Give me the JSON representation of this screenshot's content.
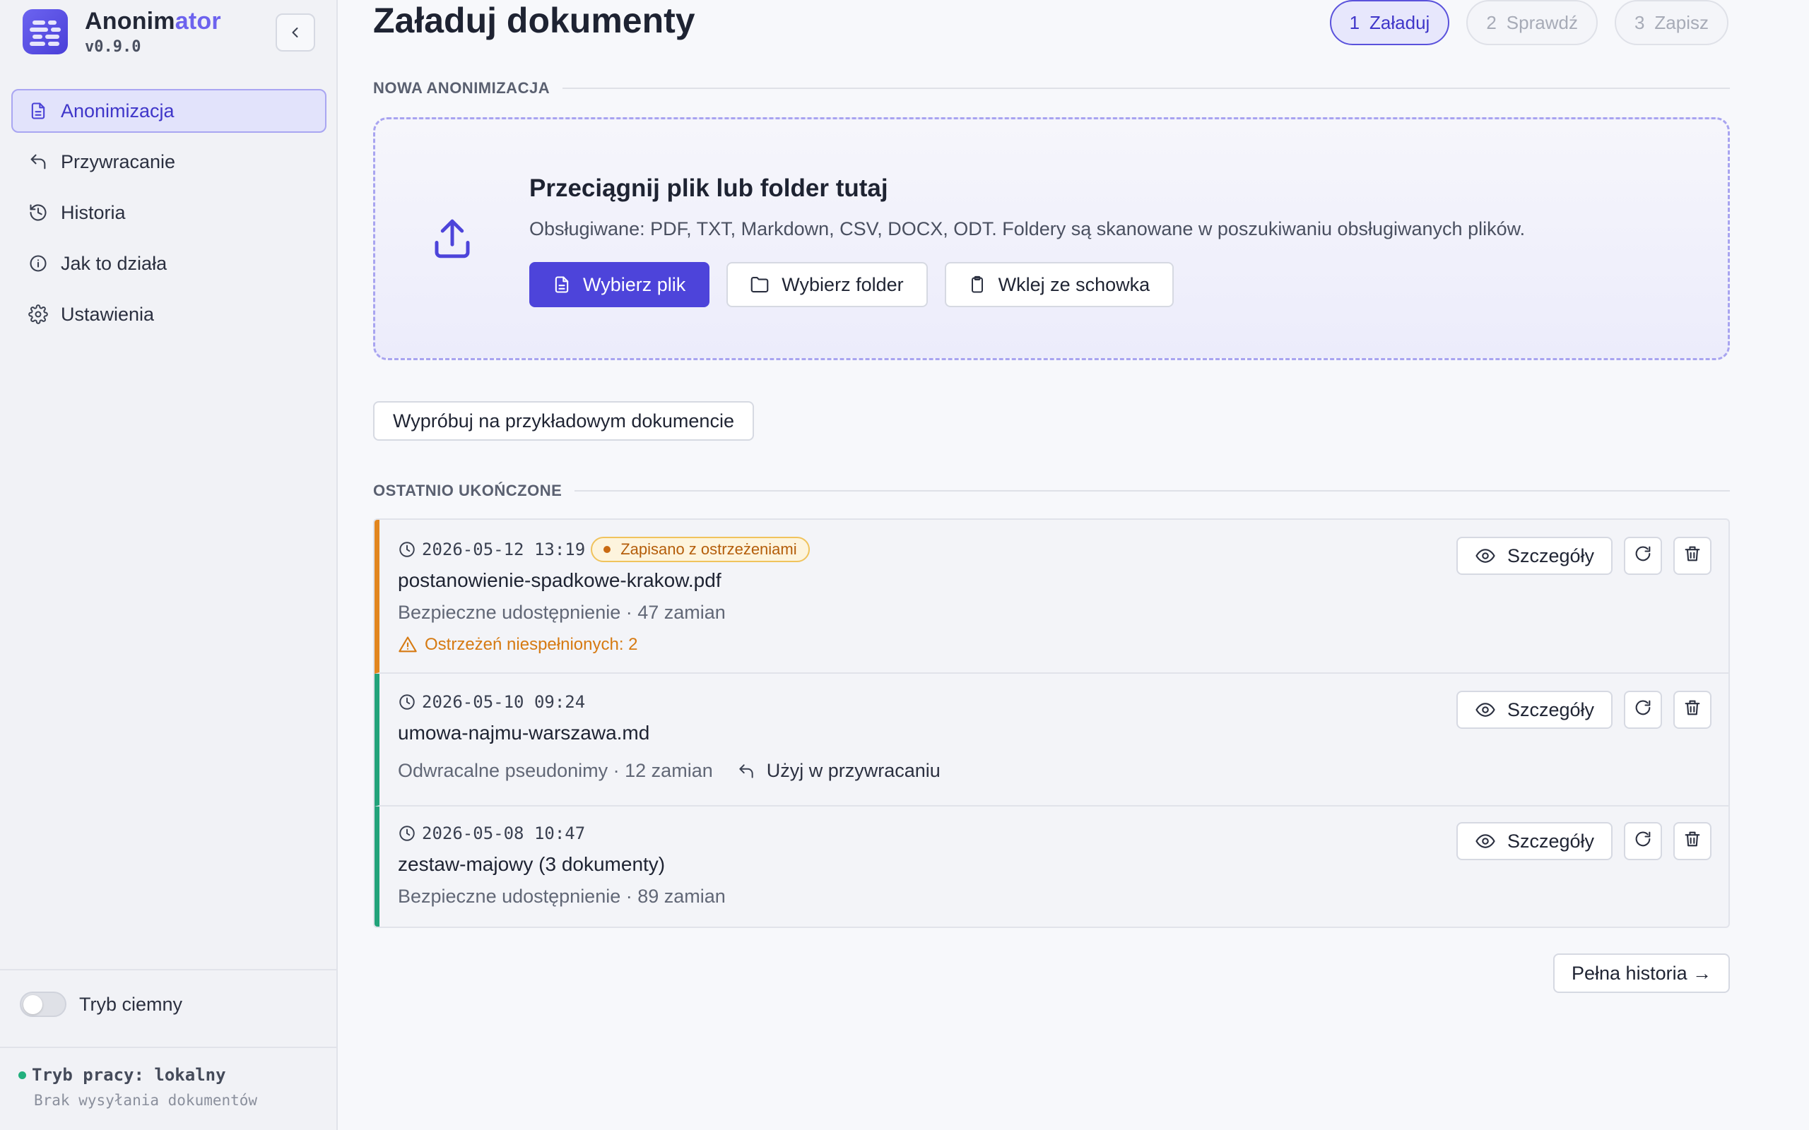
{
  "app": {
    "name_main": "Anonim",
    "name_accent": "ator",
    "version": "v0.9.0",
    "collapse_icon": "chevron-left-icon"
  },
  "nav": [
    {
      "label": "Anonimizacja",
      "icon": "document-icon",
      "active": true
    },
    {
      "label": "Przywracanie",
      "icon": "undo-icon",
      "active": false
    },
    {
      "label": "Historia",
      "icon": "history-icon",
      "active": false
    },
    {
      "label": "Jak to działa",
      "icon": "info-icon",
      "active": false
    },
    {
      "label": "Ustawienia",
      "icon": "gear-icon",
      "active": false
    }
  ],
  "dark_mode": {
    "label": "Tryb ciemny",
    "enabled": false
  },
  "work_mode": {
    "label": "Tryb pracy: lokalny",
    "sub": "Brak wysyłania dokumentów",
    "status_color": "#22b07d"
  },
  "page": {
    "title": "Załaduj dokumenty"
  },
  "steps": [
    {
      "num": "1",
      "label": "Załaduj",
      "active": true
    },
    {
      "num": "2",
      "label": "Sprawdź",
      "active": false
    },
    {
      "num": "3",
      "label": "Zapisz",
      "active": false
    }
  ],
  "new_section": {
    "label": "NOWA ANONIMIZACJA"
  },
  "dropzone": {
    "title": "Przeciągnij plik lub folder tutaj",
    "description": "Obsługiwane: PDF, TXT, Markdown, CSV, DOCX, ODT. Foldery są skanowane w poszukiwaniu obsługiwanych plików.",
    "btn_file": "Wybierz plik",
    "btn_folder": "Wybierz folder",
    "btn_clipboard": "Wklej ze schowka"
  },
  "try_sample": "Wypróbuj na przykładowym dokumencie",
  "recent_section": {
    "label": "OSTATNIO UKOŃCZONE"
  },
  "recent": [
    {
      "datetime": "2026-05-12 13:19",
      "badge": "Zapisano z ostrzeżeniami",
      "filename": "postanowienie-spadkowe-krakow.pdf",
      "summary": "Bezpieczne udostępnienie · 47 zamian",
      "warning": "Ostrzeżeń niespełnionych: 2",
      "status": "warning"
    },
    {
      "datetime": "2026-05-10 09:24",
      "filename": "umowa-najmu-warszawa.md",
      "summary": "Odwracalne pseudonimy · 12 zamian",
      "use_link": "Użyj w przywracaniu",
      "status": "ok"
    },
    {
      "datetime": "2026-05-08 10:47",
      "filename": "zestaw-majowy (3 dokumenty)",
      "summary": "Bezpieczne udostępnienie · 89 zamian",
      "status": "ok"
    }
  ],
  "details_label": "Szczegóły",
  "full_history": "Pełna historia →",
  "colors": {
    "accent": "#4d44da",
    "ok": "#22a37a",
    "warning": "#e2861e"
  }
}
